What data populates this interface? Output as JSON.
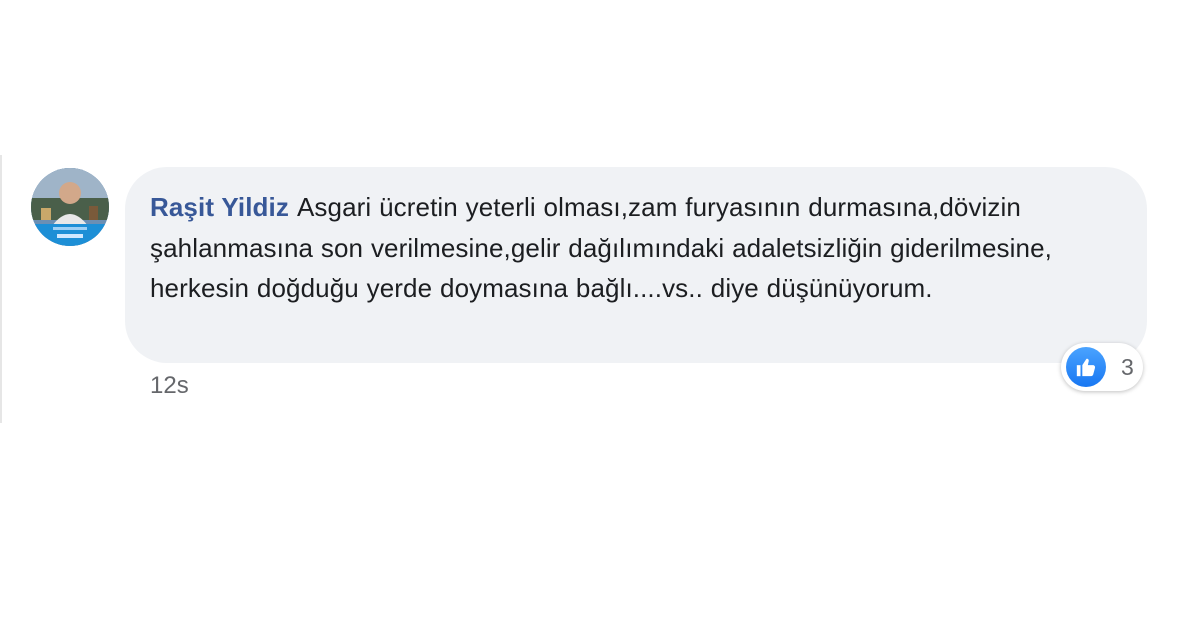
{
  "comment": {
    "author": "Raşit Yildiz",
    "text": "Asgari ücretin yeterli olması,zam furyasının durmasına,dövizin şahlanmasına son verilmesine,gelir dağılımındaki adaletsizliğin giderilmesine, herkesin doğduğu yerde doymasına bağlı....vs.. diye düşünüyorum.",
    "timestamp": "12s",
    "reactions": {
      "icon": "like-icon",
      "count": "3"
    }
  },
  "colors": {
    "bubble_bg": "#f0f2f5",
    "author_name": "#385898",
    "text": "#1c1e21",
    "meta": "#65676b",
    "like_blue": "#1877f2"
  }
}
